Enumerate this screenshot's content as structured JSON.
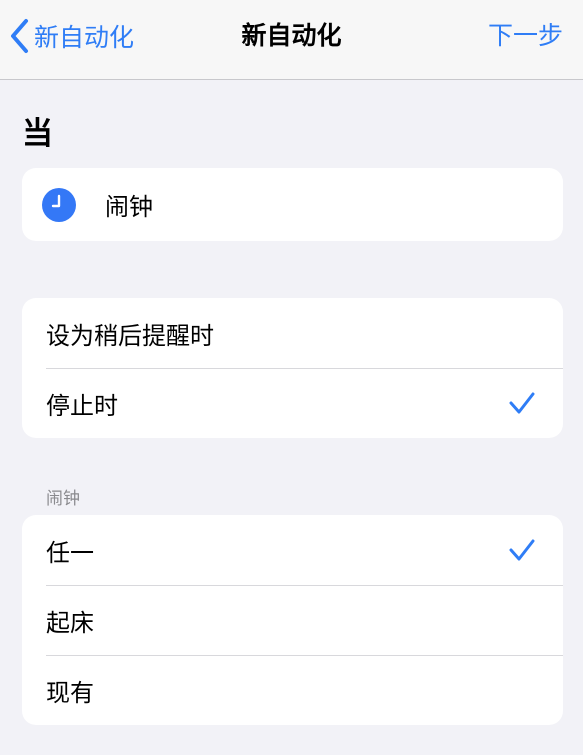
{
  "navbar": {
    "back_label": "新自动化",
    "title": "新自动化",
    "next_label": "下一步"
  },
  "when_section": {
    "heading": "当",
    "trigger": {
      "icon": "clock-icon",
      "label": "闹钟"
    }
  },
  "event_options": [
    {
      "label": "设为稍后提醒时",
      "selected": false
    },
    {
      "label": "停止时",
      "selected": true
    }
  ],
  "alarm_group": {
    "label": "闹钟",
    "items": [
      {
        "label": "任一",
        "selected": true
      },
      {
        "label": "起床",
        "selected": false
      },
      {
        "label": "现有",
        "selected": false
      }
    ]
  },
  "colors": {
    "accent": "#2f7df6",
    "background": "#f2f2f7",
    "card": "#ffffff",
    "clock_icon": "#3478f6"
  }
}
